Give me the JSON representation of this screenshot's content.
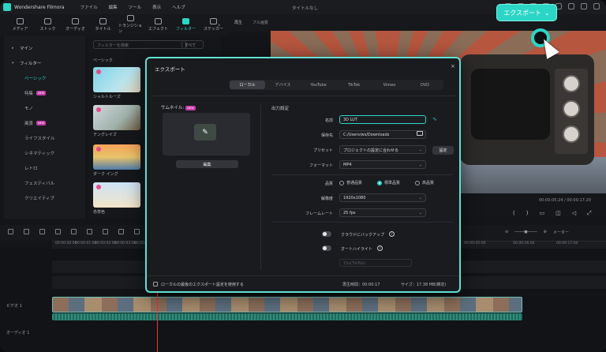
{
  "app": {
    "name": "Wondershare Filmora",
    "window_title": "タイトルなし"
  },
  "menus": [
    "ファイル",
    "編集",
    "ツール",
    "表示",
    "ヘルプ"
  ],
  "toolbar": [
    {
      "label": "メディア",
      "icon": "media-icon"
    },
    {
      "label": "ストック",
      "icon": "stock-icon"
    },
    {
      "label": "オーディオ",
      "icon": "audio-icon"
    },
    {
      "label": "タイトル",
      "icon": "title-icon"
    },
    {
      "label": "トランジション",
      "icon": "transition-icon"
    },
    {
      "label": "エフェクト",
      "icon": "effect-icon"
    },
    {
      "label": "フィルター",
      "icon": "filter-icon",
      "active": true
    },
    {
      "label": "ステッカー",
      "icon": "sticker-icon"
    }
  ],
  "sidebar": {
    "items": [
      {
        "label": "マイン"
      },
      {
        "label": "フィルター"
      },
      {
        "label": "ベーシック",
        "selected": true
      },
      {
        "label": "特集",
        "badge": "NEW"
      },
      {
        "label": "モノ"
      },
      {
        "label": "風景",
        "badge": "NEW"
      },
      {
        "label": "ライフスタイル"
      },
      {
        "label": "シネマティック"
      },
      {
        "label": "レトロ"
      },
      {
        "label": "フェスティバル"
      },
      {
        "label": "クリエイティブ"
      }
    ]
  },
  "assets": {
    "search_placeholder": "フィルターを検索",
    "filter_label": "すべて",
    "section_title": "ベーシック",
    "items": [
      "シャルトルーズ",
      "テングレイズ",
      "ダーク イング",
      "赤茶色"
    ]
  },
  "preview": {
    "player_label": "再生",
    "quality_label": "フル画質",
    "timecode": "00:00:05:24 / 00:00:17:20"
  },
  "export_button": {
    "label": "エクスポート"
  },
  "timeline": {
    "ruler": [
      "00:00:00:00",
      "00:00:01:00",
      "00:00:02:00",
      "00:00:03:00",
      "00:00:04:00",
      "00:00:05:00",
      "00:00:16:00",
      "00:00:17:00"
    ],
    "zoom_label": "メーター",
    "video_track": "ビデオ 1",
    "audio_track": "オーディオ 1"
  },
  "dialog": {
    "title": "エクスポート",
    "tabs": [
      {
        "label": "ローカル",
        "active": true
      },
      {
        "label": "デバイス"
      },
      {
        "label": "YouTube"
      },
      {
        "label": "TikTok"
      },
      {
        "label": "Vimeo"
      },
      {
        "label": "DVD"
      }
    ],
    "thumbnail_label": "サムネイル:",
    "thumbnail_badge": "NEW",
    "edit_button": "編集",
    "output_section": "出力設定",
    "fields": {
      "name_label": "名前",
      "name_value": "3D LUT",
      "save_label": "保存先",
      "save_value": "C:/Users/ws/Downloads",
      "preset_label": "プリセット",
      "preset_value": "プロジェクトの設定に合わせる",
      "settings_button": "設定",
      "format_label": "フォーマット",
      "format_value": "MP4",
      "quality_label": "品質",
      "quality_options": [
        "普通品質",
        "標準品質",
        "高品質"
      ],
      "quality_selected": "標準品質",
      "resolution_label": "解像度",
      "resolution_value": "1920x1080",
      "framerate_label": "フレームレート",
      "framerate_value": "25 fps",
      "cloud_backup_label": "クラウドにバックアップ",
      "auto_highlight_label": "オートハイライト",
      "auto_highlight_value": "15s(TikTok)"
    },
    "footer": {
      "checkbox_label": "ローカルの最後のエクスポート設定を使用する",
      "duration": "再生時間：00:00:17",
      "size": "サイズ：17.38 MB(推定)"
    }
  }
}
